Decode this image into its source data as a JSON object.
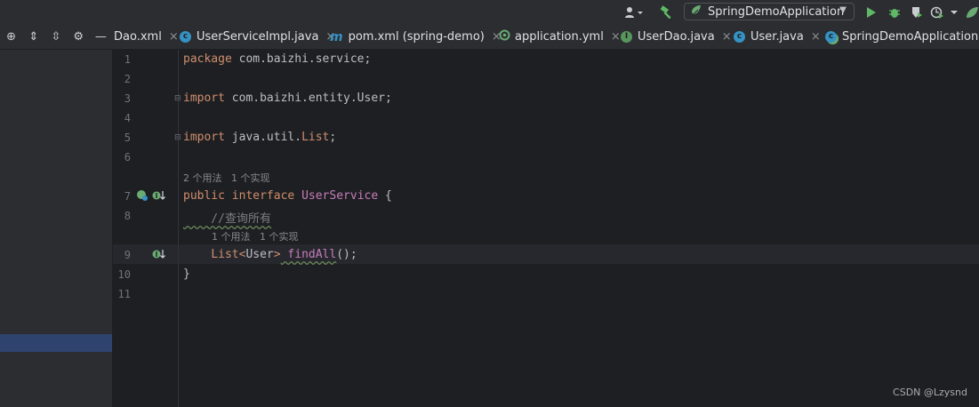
{
  "toolbar": {
    "run_config": "SpringDemoApplication",
    "icons": [
      "user-icon",
      "build-hammer-icon",
      "spring-run-icon",
      "run-icon",
      "debug-icon",
      "coverage-icon",
      "profile-icon",
      "more-icon",
      "update-icon"
    ]
  },
  "tabs": [
    {
      "label": "Dao.xml",
      "icon": "xml-file-icon"
    },
    {
      "label": "UserServiceImpl.java",
      "icon": "class-icon"
    },
    {
      "label": "pom.xml (spring-demo)",
      "icon": "maven-icon"
    },
    {
      "label": "application.yml",
      "icon": "spring-config-icon"
    },
    {
      "label": "UserDao.java",
      "icon": "interface-icon"
    },
    {
      "label": "User.java",
      "icon": "class-icon"
    },
    {
      "label": "SpringDemoApplication.java",
      "icon": "spring-boot-icon"
    }
  ],
  "tab_close": "×",
  "editor": {
    "line_numbers": [
      "1",
      "2",
      "3",
      "4",
      "5",
      "6",
      "7",
      "8",
      "9",
      "10",
      "11"
    ],
    "code": {
      "l1_kw": "package",
      "l1_rest": " com.baizhi.service;",
      "l3_kw": "import",
      "l3_rest": " com.baizhi.entity.User;",
      "l5_kw": "import",
      "l5_rest": " java.util.",
      "l5_cls": "List",
      "l5_end": ";",
      "hint1": "2 个用法   1 个实现",
      "l7_kw1": "public",
      "l7_kw2": " interface",
      "l7_name": " UserService",
      "l7_end": " {",
      "l8_comment": "    //查询所有",
      "hint2": "1 个用法   1 个实现",
      "l9_indent": "    ",
      "l9_type": "List",
      "l9_lt": "<",
      "l9_gen": "User",
      "l9_gt": ">",
      "l9_fn": " findAll",
      "l9_end": "();",
      "l10": "}"
    }
  },
  "watermark": "CSDN @Lzysnd",
  "colors": {
    "keyword": "#cf8e6d",
    "class": "#c77dbb",
    "comment": "#7a7e85",
    "selection": "#2e436e"
  }
}
